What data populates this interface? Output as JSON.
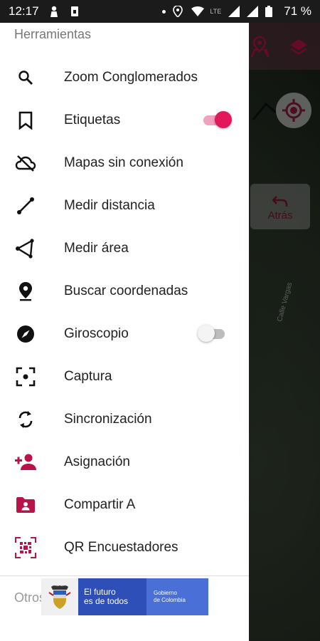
{
  "status_bar": {
    "time": "12:17",
    "network": "LTE",
    "battery": "71 %"
  },
  "map": {
    "back_button_label": "Atrás",
    "road_label": "Calle Vargas"
  },
  "drawer": {
    "section_title": "Herramientas",
    "items": [
      {
        "label": "Zoom Conglomerados",
        "icon": "search-icon"
      },
      {
        "label": "Etiquetas",
        "icon": "bookmark-icon",
        "toggle": true
      },
      {
        "label": "Mapas sin conexión",
        "icon": "cloud-off-icon"
      },
      {
        "label": "Medir distancia",
        "icon": "line-measure-icon"
      },
      {
        "label": "Medir área",
        "icon": "polygon-measure-icon"
      },
      {
        "label": "Buscar coordenadas",
        "icon": "location-pin-icon"
      },
      {
        "label": "Giroscopio",
        "icon": "compass-icon",
        "toggle": false
      },
      {
        "label": "Captura",
        "icon": "capture-frame-icon"
      },
      {
        "label": "Sincronización",
        "icon": "sync-icon"
      },
      {
        "label": "Asignación",
        "icon": "person-add-icon"
      },
      {
        "label": "Compartir A",
        "icon": "shared-folder-icon"
      },
      {
        "label": "QR Encuestadores",
        "icon": "qr-code-icon"
      }
    ],
    "next_section_title": "Otros"
  },
  "banner": {
    "slogan_line1": "El futuro",
    "slogan_line2": "es de todos",
    "gov_line1": "Gobierno",
    "gov_line2": "de Colombia"
  },
  "colors": {
    "accent": "#b8144a",
    "toggle_on": "#e2185b"
  }
}
